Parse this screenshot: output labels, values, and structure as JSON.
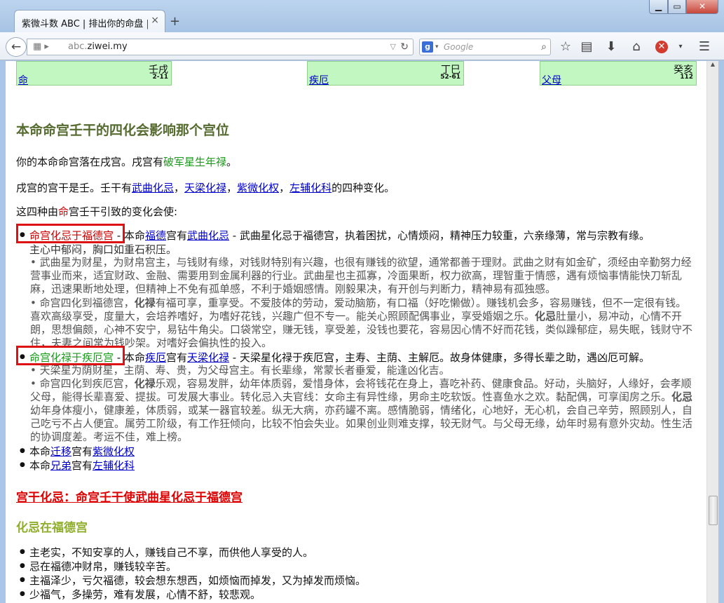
{
  "browser": {
    "tab_title": "紫微斗数 ABC | 排出你的命盘 | ...",
    "tab_close": "×",
    "new_tab": "+",
    "url_domain": "abc.",
    "url_host": "ziwei.my",
    "search_placeholder": "Google",
    "search_engine_letter": "g"
  },
  "palaces": [
    {
      "name": "命",
      "stem": "壬戌",
      "age": "2-11"
    },
    {
      "name": "疾厄",
      "stem": "丁巳",
      "age": "52-61"
    },
    {
      "name": "父母",
      "stem": "癸亥",
      "age": "112"
    }
  ],
  "section1": {
    "title": "本命命宫壬干的四化会影响那个宫位",
    "p1_pre": "你的本命命宫落在戌宫。戌宫有",
    "p1_star": "破军星生年禄",
    "p1_post": "。",
    "p2_pre": "戌宫的宫干是壬。壬干有",
    "p2_l1": "武曲化忌",
    "p2_sep": "，",
    "p2_l2": "天梁化禄",
    "p2_l3": "紫微化权",
    "p2_l4": "左辅化科",
    "p2_post": "的四种变化。",
    "p3_pre": "这四种由",
    "p3_ming": "命",
    "p3_post": "宫壬干引致的变化会使:"
  },
  "items": {
    "i1_tag": "命宫化忌于福德宫",
    "i1_mid1": " - 本命",
    "i1_link1": "福德",
    "i1_mid2": "宫有",
    "i1_link2": "武曲化忌",
    "i1_rest": " - 武曲星化忌于福德宫，执着困扰，心情烦闷，精神压力较重，六亲缘薄，常与宗教有缘。",
    "i1_line2": "主心中郁闷，胸口如重石积压。",
    "i1_d1": "• 武曲星为财星，为财帛宫主，与钱财有缘，对钱财特别有兴趣，也很有赚钱的欲望，通常都善于理财。武曲之财有如金矿，须经由辛勤努力经营事业而来，适宜财政、金融、需要用到金属利器的行业。武曲星也主孤寡，冷面果断，权力欲高，理智重于情感，遇有烦恼事情能快刀斩乱麻，迅速果断地处理，但精神上不免有孤单感，不利于婚姻感情。刚毅果决，有开创与判断力，精神易有孤独感。",
    "i1_d2_pre": "• 命宫四化到福德宫，",
    "i1_d2_b1": "化禄",
    "i1_d2_mid": "有福可享，重享受。不爱肢体的劳动，爱动脑筋，有口福（好吃懒做）。赚钱机会多，容易赚钱，但不一定很有钱。喜欢高级享受，度量大，会培养嗜好，为嗜好花钱，兴趣广但不专一。能关心照顾配偶事业，享受婚姻之乐。",
    "i1_d2_b2": "化忌",
    "i1_d2_post": "肚量小，易冲动，心情不开朗，思想偏颇，心神不安宁，易钻牛角尖。口袋常空，赚无钱，享受差，没钱也要花，容易因心情不好而花钱，类似躁郁症，易失眠，钱财守不住，夫妻之间常为钱吵架。对嗜好会偏执性的投入。",
    "i2_tag": "命宫化禄于疾厄宫",
    "i2_mid1": " - 本命",
    "i2_link1": "疾厄",
    "i2_mid2": "宫有",
    "i2_link2": "天梁化禄",
    "i2_rest": " - 天梁星化禄于疾厄宫，主寿、主荫、主解厄。故身体健康，多得长辈之助，遇凶厄可解。",
    "i2_d1": "• 天梁星为荫财星，主荫、寿、贵，为父母宫主。有长辈缘，常蒙长者垂爱，能逢凶化吉。",
    "i2_d2_pre": "• 命宫四化到疾厄宫，",
    "i2_d2_b1": "化禄",
    "i2_d2_mid": "乐观，容易发胖，幼年体质弱，爱惜身体，会将钱花在身上，喜吃补药、健康食品。好动，头脑好，人缘好，会孝顺父母，能得长辈喜爱、提拔。可发展大事业。转化忌入夫官线：女命主有异性缘，男命主吃软饭。性喜鱼水之欢。黏配偶，可享闺房之乐。",
    "i2_d2_b2": "化忌",
    "i2_d2_post": "幼年身体瘦小，健康差，体质弱，或某一器官较差。纵无大病，亦药罐不离。感情脆弱，情绪化，心地好，无心机，会自己辛劳，照顾别人，自己吃亏不占人便宜。属劳工阶级，有工作狂倾向，比较不怕会失业。如果创业则难支撑，较无财气。与父母无缘，幼年时易有意外灾劫。性生活的协调度差。考运不佳，难上榜。",
    "i3_pre": "本命",
    "i3_link1": "迁移",
    "i3_mid": "宫有",
    "i3_link2": "紫微化权",
    "i4_pre": "本命",
    "i4_link1": "兄弟",
    "i4_mid": "宫有",
    "i4_link2": "左辅化科"
  },
  "section2": {
    "title": "宫干化忌：命宫壬干使武曲星化忌于福德宫",
    "subtitle": "化忌在福德宫",
    "bullets": [
      "主老实，不知安享的人，赚钱自己不享，而供他人享受的人。",
      "忌在福德冲财帛，赚钱较辛苦。",
      "主福泽少，亏欠福德，较会想东想西，如烦恼而掉发，又为掉发而烦恼。",
      "少福气，多操劳，难有发展，心情不舒，较悲观。"
    ]
  }
}
